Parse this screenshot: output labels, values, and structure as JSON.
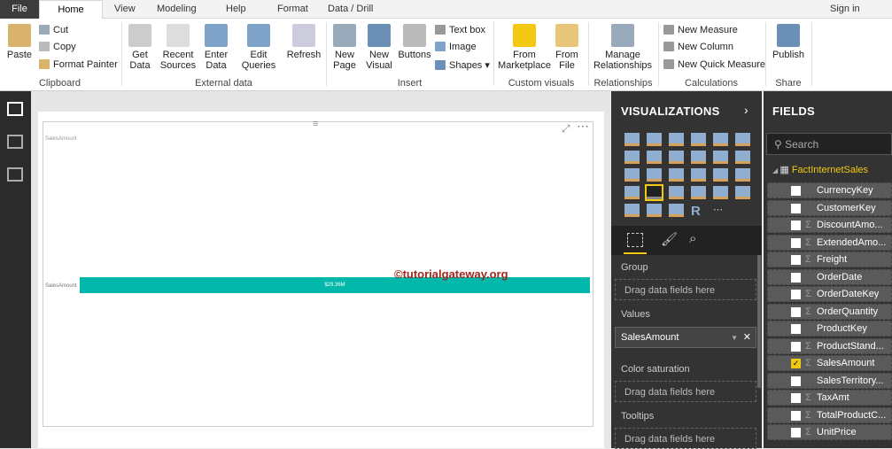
{
  "menu": {
    "file": "File",
    "tabs": [
      "Home",
      "View",
      "Modeling",
      "Help",
      "Format",
      "Data / Drill"
    ],
    "signin": "Sign in"
  },
  "ribbon": {
    "clipboard": {
      "paste": "Paste",
      "cut": "Cut",
      "copy": "Copy",
      "format_painter": "Format Painter",
      "label": "Clipboard"
    },
    "external": {
      "get_data": "Get Data",
      "recent": "Recent Sources",
      "enter": "Enter Data",
      "edit": "Edit Queries",
      "refresh": "Refresh",
      "label": "External data"
    },
    "insert": {
      "new_page": "New Page",
      "new_visual": "New Visual",
      "buttons": "Buttons",
      "text_box": "Text box",
      "image": "Image",
      "shapes": "Shapes",
      "label": "Insert"
    },
    "custom": {
      "marketplace": "From Marketplace",
      "file": "From File",
      "label": "Custom visuals"
    },
    "relationships": {
      "manage": "Manage Relationships",
      "label": "Relationships"
    },
    "calculations": {
      "measure": "New Measure",
      "column": "New Column",
      "quick": "New Quick Measure",
      "label": "Calculations"
    },
    "share": {
      "publish": "Publish",
      "label": "Share"
    }
  },
  "visual": {
    "title": "SalesAmount",
    "axis_label": "SalesAmount",
    "value_label": "$29.36M",
    "watermark": "©tutorialgateway.org"
  },
  "chart_data": {
    "type": "bar",
    "categories": [
      "SalesAmount"
    ],
    "values": [
      29.36
    ],
    "unit": "$M",
    "title": "SalesAmount"
  },
  "visualizations": {
    "title": "VISUALIZATIONS",
    "group": "Group",
    "drag": "Drag data fields here",
    "values": "Values",
    "values_field": "SalesAmount",
    "color_saturation": "Color saturation",
    "tooltips": "Tooltips"
  },
  "fields_pane": {
    "title": "FIELDS",
    "search": "Search",
    "table": "FactInternetSales",
    "items": [
      {
        "name": "CurrencyKey",
        "sigma": false,
        "checked": false
      },
      {
        "name": "CustomerKey",
        "sigma": false,
        "checked": false
      },
      {
        "name": "DiscountAmo...",
        "sigma": true,
        "checked": false
      },
      {
        "name": "ExtendedAmo...",
        "sigma": true,
        "checked": false
      },
      {
        "name": "Freight",
        "sigma": true,
        "checked": false
      },
      {
        "name": "OrderDate",
        "sigma": false,
        "checked": false
      },
      {
        "name": "OrderDateKey",
        "sigma": true,
        "checked": false
      },
      {
        "name": "OrderQuantity",
        "sigma": true,
        "checked": false
      },
      {
        "name": "ProductKey",
        "sigma": false,
        "checked": false
      },
      {
        "name": "ProductStand...",
        "sigma": true,
        "checked": false
      },
      {
        "name": "SalesAmount",
        "sigma": true,
        "checked": true
      },
      {
        "name": "SalesTerritory...",
        "sigma": false,
        "checked": false
      },
      {
        "name": "TaxAmt",
        "sigma": true,
        "checked": false
      },
      {
        "name": "TotalProductC...",
        "sigma": true,
        "checked": false
      },
      {
        "name": "UnitPrice",
        "sigma": true,
        "checked": false
      }
    ]
  },
  "colors": {
    "bar": "#01b8aa",
    "accent": "#f2c811"
  }
}
